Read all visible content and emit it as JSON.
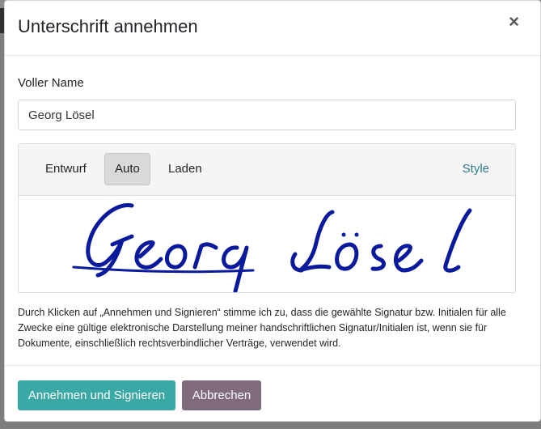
{
  "modal": {
    "title": "Unterschrift annehmen",
    "close_symbol": "×"
  },
  "form": {
    "name_label": "Voller Name",
    "name_value": "Georg Lösel"
  },
  "signature": {
    "tabs": [
      {
        "label": "Entwurf",
        "active": false
      },
      {
        "label": "Auto",
        "active": true
      },
      {
        "label": "Laden",
        "active": false
      }
    ],
    "style_label": "Style",
    "rendered_text": "Georg Lösel",
    "ink_color": "#0a1a9c"
  },
  "legal_text": "Durch Klicken auf „Annehmen und Signieren“ stimme ich zu, dass die gewählte Signatur bzw. Initialen für alle Zwecke eine gültige elektronische Darstellung meiner handschriftlichen Signatur/Initialen ist, wenn sie für Dokumente, einschließlich rechtsverbindlicher Verträge, verwendet wird.",
  "footer": {
    "accept_label": "Annehmen und Signieren",
    "cancel_label": "Abbrechen"
  },
  "colors": {
    "accept_button": "#3aa8a4",
    "cancel_button": "#7f6a7e",
    "style_link": "#2d7b8a"
  }
}
